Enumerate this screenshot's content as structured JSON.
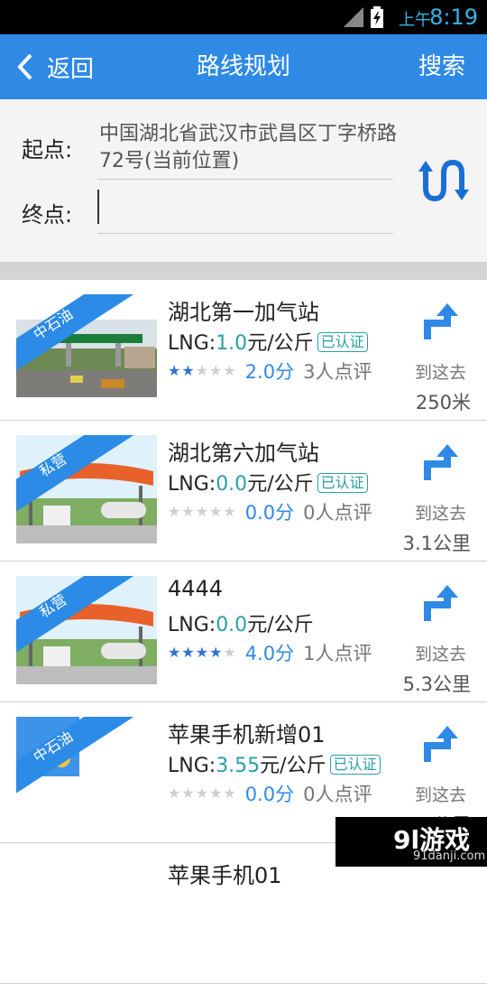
{
  "status_bar": {
    "ampm": "上午",
    "time": "8:19"
  },
  "header": {
    "back_label": "返回",
    "title": "路线规划",
    "search_label": "搜索"
  },
  "route": {
    "start_label": "起点:",
    "start_value": "中国湖北省武汉市武昌区丁字桥路72号(当前位置)",
    "end_label": "终点:",
    "end_value": ""
  },
  "stations": [
    {
      "tag": "中石油",
      "name": "湖北第一加气站",
      "price_prefix": "LNG:",
      "price": "1.0",
      "unit": "元/公斤",
      "certified": "已认证",
      "stars": 2,
      "score": "2.0分",
      "reviews": "3人点评",
      "go_label": "到这去",
      "distance": "250米",
      "image": "station-photo"
    },
    {
      "tag": "私营",
      "name": "湖北第六加气站",
      "price_prefix": "LNG:",
      "price": "0.0",
      "unit": "元/公斤",
      "certified": "已认证",
      "stars": 0,
      "score": "0.0分",
      "reviews": "0人点评",
      "go_label": "到这去",
      "distance": "3.1公里",
      "image": "station-illustration"
    },
    {
      "tag": "私营",
      "name": "4444",
      "price_prefix": "LNG:",
      "price": "0.0",
      "unit": "元/公斤",
      "certified": "",
      "stars": 4,
      "score": "4.0分",
      "reviews": "1人点评",
      "go_label": "到这去",
      "distance": "5.3公里",
      "image": "station-illustration"
    },
    {
      "tag": "中石油",
      "name": "苹果手机新增01",
      "price_prefix": "LNG:",
      "price": "3.55",
      "unit": "元/公斤",
      "certified": "已认证",
      "stars": 0,
      "score": "0.0分",
      "reviews": "0人点评",
      "go_label": "到这去",
      "distance": "5.6公里",
      "image": "placeholder"
    },
    {
      "tag": "",
      "name": "苹果手机01",
      "price_prefix": "",
      "price": "",
      "unit": "",
      "certified": "",
      "stars": 0,
      "score": "",
      "reviews": "",
      "go_label": "",
      "distance": "",
      "image": ""
    }
  ],
  "watermark": {
    "big": "9l游戏",
    "small": "91danji.com"
  },
  "colors": {
    "accent": "#2f8ae5",
    "price": "#2aa0a5",
    "star_on": "#2f73d4"
  }
}
